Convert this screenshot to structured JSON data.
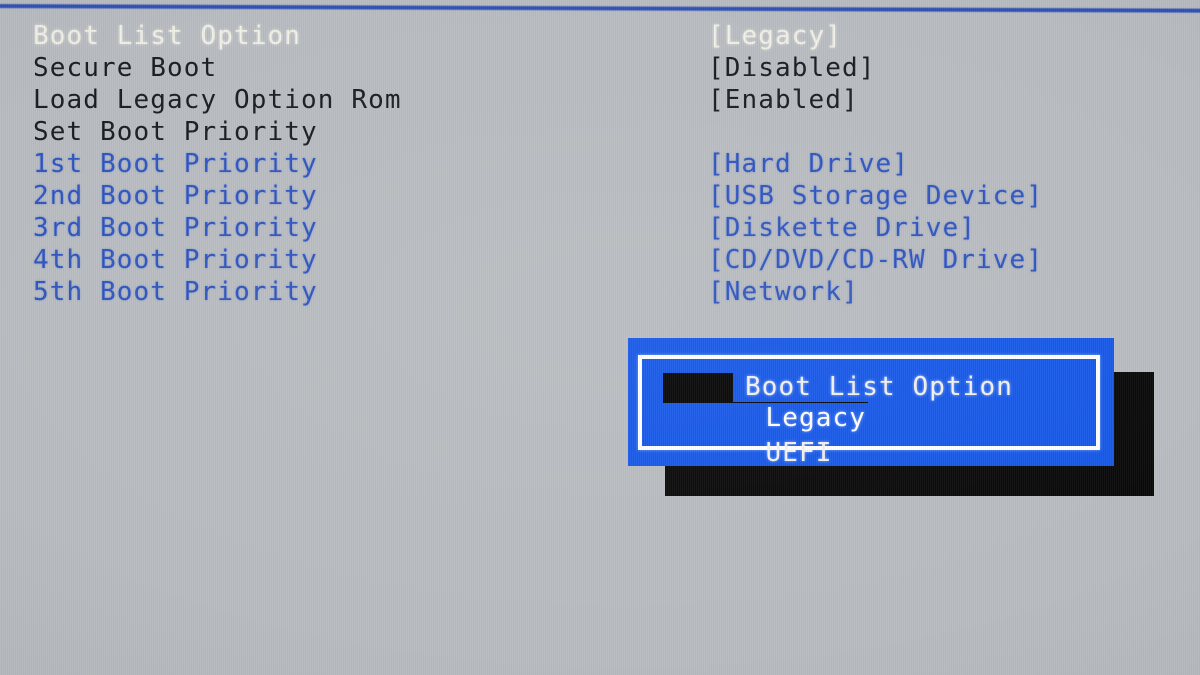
{
  "screen": {
    "background_color": "#b9bdc1",
    "accent_blue": "#2f54bd",
    "dialog_blue": "#1658e8",
    "highlight_bg": "#050505",
    "white_text": "#f3f0e4"
  },
  "settings": {
    "rows": [
      {
        "label": "Boot List Option",
        "value": "[Legacy]",
        "label_style": "white",
        "value_style": "white"
      },
      {
        "label": "Secure Boot",
        "value": "[Disabled]",
        "label_style": "black",
        "value_style": "black"
      },
      {
        "label": "Load Legacy Option Rom",
        "value": "[Enabled]",
        "label_style": "black",
        "value_style": "black"
      },
      {
        "label": "Set Boot Priority",
        "value": "",
        "label_style": "black",
        "value_style": "black"
      },
      {
        "label": "1st Boot Priority",
        "value": "[Hard Drive]",
        "label_style": "blue",
        "value_style": "blue"
      },
      {
        "label": "2nd Boot Priority",
        "value": "[USB Storage Device]",
        "label_style": "blue",
        "value_style": "blue"
      },
      {
        "label": "3rd Boot Priority",
        "value": "[Diskette Drive]",
        "label_style": "blue",
        "value_style": "blue"
      },
      {
        "label": "4th Boot Priority",
        "value": "[CD/DVD/CD-RW Drive]",
        "label_style": "blue",
        "value_style": "blue"
      },
      {
        "label": "5th Boot Priority",
        "value": "[Network]",
        "label_style": "blue",
        "value_style": "blue"
      }
    ]
  },
  "dialog": {
    "title": "Boot List Option",
    "options": [
      {
        "label": "Legacy",
        "selected": true
      },
      {
        "label": "UEFI",
        "selected": false
      }
    ]
  }
}
